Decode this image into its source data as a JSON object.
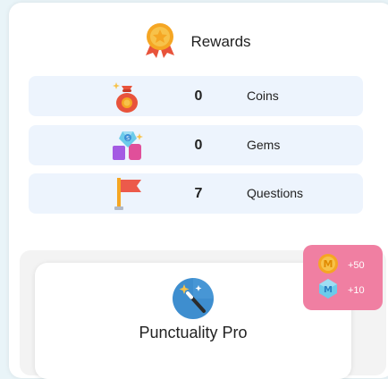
{
  "header": {
    "title": "Rewards",
    "icon": "medal-icon"
  },
  "stats": [
    {
      "icon": "money-bag-icon",
      "value": "0",
      "label": "Coins"
    },
    {
      "icon": "gems-icon",
      "value": "0",
      "label": "Gems"
    },
    {
      "icon": "flag-icon",
      "value": "7",
      "label": "Questions"
    }
  ],
  "badge_card": {
    "title": "Punctuality Pro",
    "icon": "magic-wand-icon"
  },
  "reward_popup": [
    {
      "icon": "coin-icon",
      "amount": "+50"
    },
    {
      "icon": "gem-icon",
      "amount": "+10"
    }
  ],
  "colors": {
    "row_bg": "#edf4fd",
    "popup_bg": "#f07fa2",
    "accent_orange": "#f5a623"
  }
}
